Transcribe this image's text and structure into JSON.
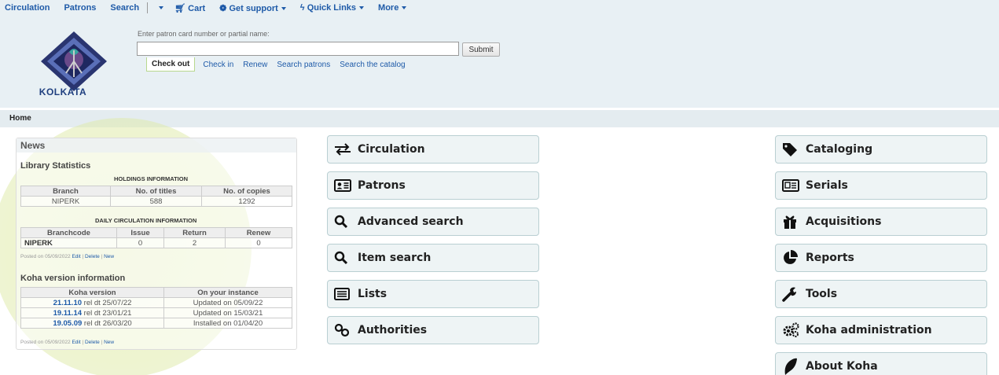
{
  "topnav": {
    "circulation": "Circulation",
    "patrons": "Patrons",
    "search": "Search",
    "cart": "Cart",
    "support": "Get support",
    "quicklinks": "Quick Links",
    "more": "More"
  },
  "logo": {
    "text": "KOLKATA"
  },
  "patron_search": {
    "label": "Enter patron card number or partial name:",
    "value": "",
    "submit": "Submit"
  },
  "circ_tabs": [
    "Check out",
    "Check in",
    "Renew",
    "Search patrons",
    "Search the catalog"
  ],
  "breadcrumb": "Home",
  "news": {
    "title": "News",
    "library_stats": {
      "title": "Library Statistics",
      "holdings_caption": "HOLDINGS INFORMATION",
      "holdings_headers": [
        "Branch",
        "No. of titles",
        "No. of copies"
      ],
      "holdings_row": [
        "NIPERK",
        "588",
        "1292"
      ],
      "daily_caption": "DAILY CIRCULATION INFORMATION",
      "daily_headers": [
        "Branchcode",
        "Issue",
        "Return",
        "Renew"
      ],
      "daily_row": [
        "NIPERK",
        "0",
        "2",
        "0"
      ]
    },
    "posted1": {
      "text": "Posted on 05/09/2022",
      "edit": "Edit",
      "delete": "Delete",
      "new": "New"
    },
    "version_info": {
      "title": "Koha version information",
      "headers": [
        "Koha version",
        "On your instance"
      ],
      "rows": [
        {
          "version": "21.11.10",
          "rel": " rel dt 25/07/22",
          "instance": "Updated on 05/09/22"
        },
        {
          "version": "19.11.14",
          "rel": " rel dt 23/01/21",
          "instance": "Updated on 15/03/21"
        },
        {
          "version": "19.05.09",
          "rel": " rel dt 26/03/20",
          "instance": "Installed on 01/04/20"
        }
      ]
    },
    "posted2": {
      "text": "Posted on 05/09/2022",
      "edit": "Edit",
      "delete": "Delete",
      "new": "New"
    }
  },
  "modules_left": [
    "Circulation",
    "Patrons",
    "Advanced search",
    "Item search",
    "Lists",
    "Authorities"
  ],
  "modules_right": [
    "Cataloging",
    "Serials",
    "Acquisitions",
    "Reports",
    "Tools",
    "Koha administration",
    "About Koha"
  ]
}
